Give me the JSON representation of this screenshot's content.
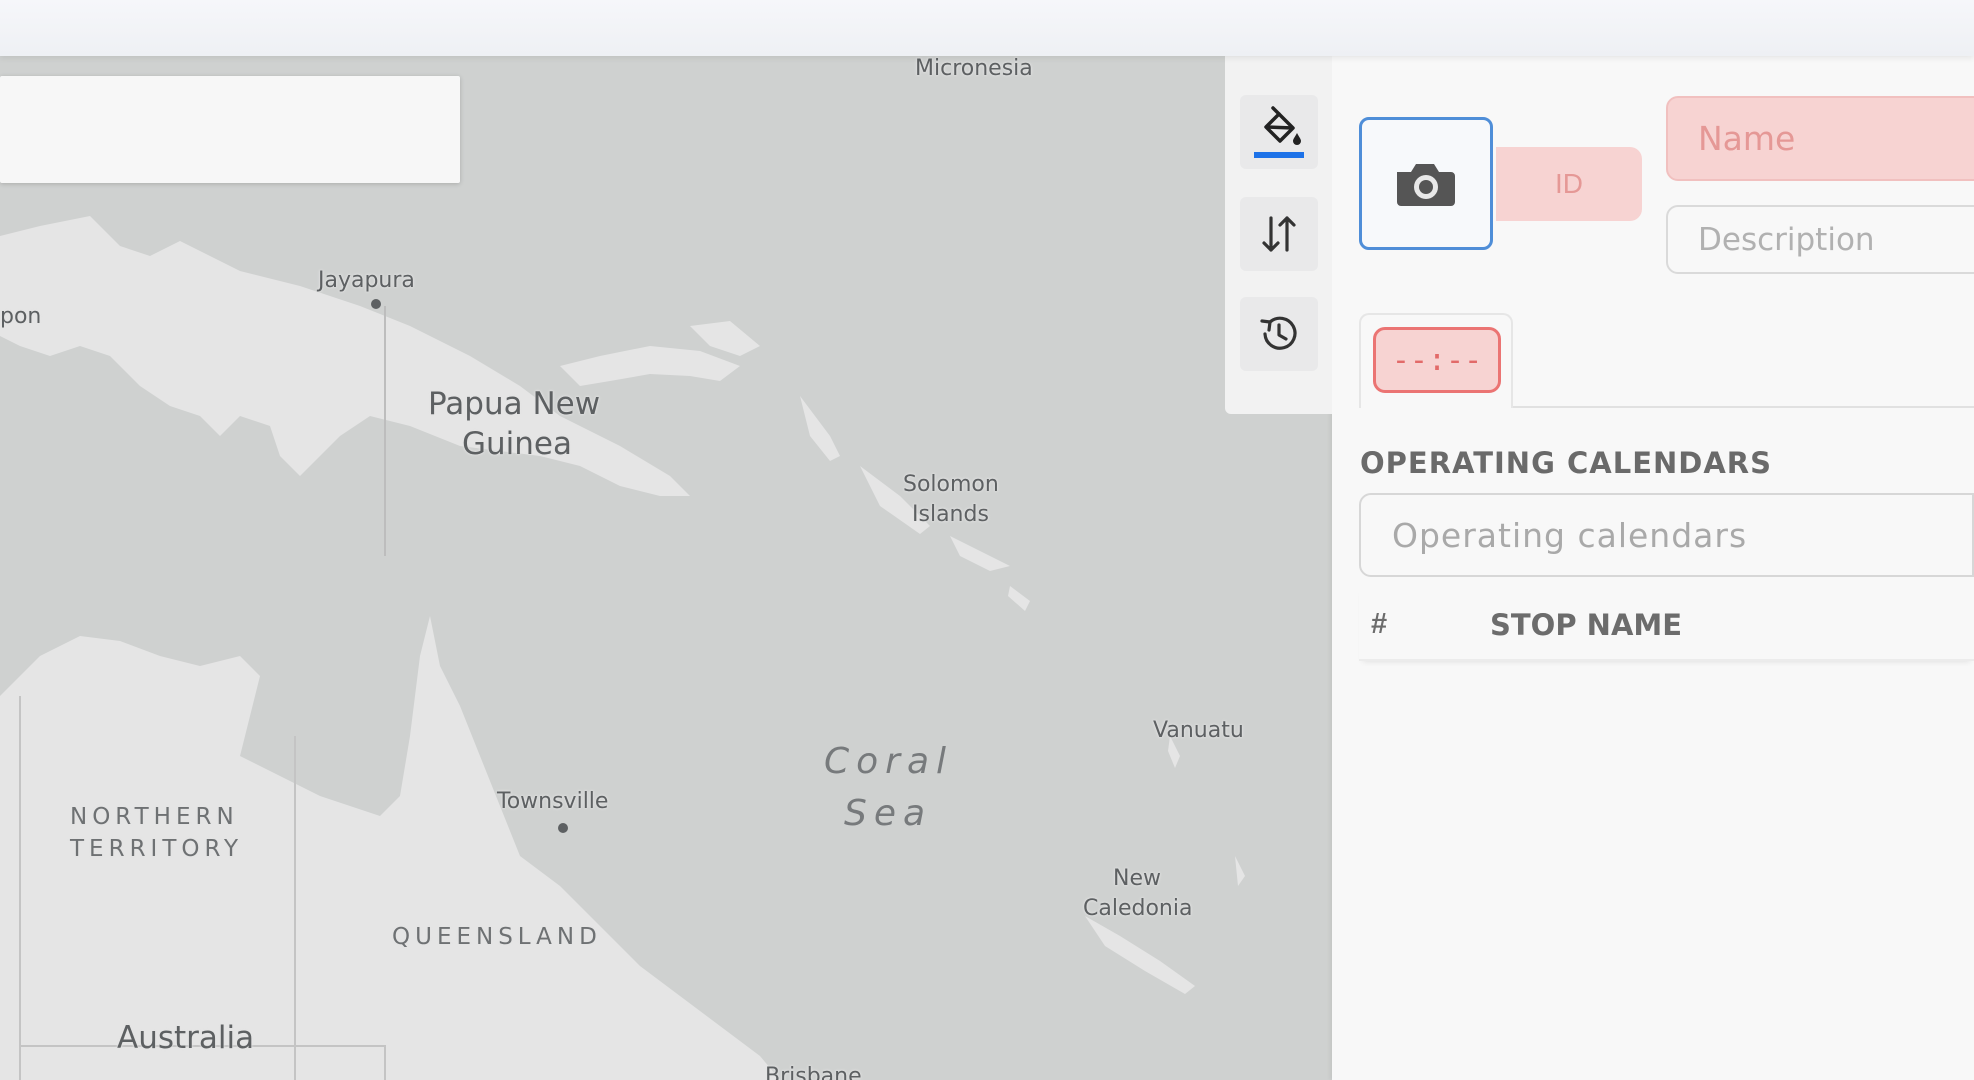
{
  "map": {
    "labels": {
      "micronesia": "Micronesia",
      "jayapura": "Jayapura",
      "pon": "pon",
      "papua_new": "Papua New",
      "guinea": "Guinea",
      "solomon": "Solomon",
      "islands": "Islands",
      "vanuatu": "Vanuatu",
      "coral": "Coral",
      "sea": "Sea",
      "townsville": "Townsville",
      "new": "New",
      "caledonia": "Caledonia",
      "northern": "NORTHERN",
      "territory": "TERRITORY",
      "queensland": "QUEENSLAND",
      "australia": "Australia",
      "brisbane": "Brisbane"
    },
    "colors": {
      "water": "#cfd1d0",
      "land": "#e5e5e5"
    }
  },
  "toolbar": {
    "icons": [
      "paint-bucket-icon",
      "sort-arrows-icon",
      "history-icon"
    ]
  },
  "panel": {
    "id_placeholder": "ID",
    "name_placeholder": "Name",
    "description_placeholder": "Description",
    "time_value": "--:--",
    "section_title": "OPERATING CALENDARS",
    "calendars_placeholder": "Operating calendars",
    "table": {
      "col_hash": "#",
      "col_stop_name": "STOP NAME"
    }
  },
  "colors": {
    "accent_blue": "#4f8ed8",
    "error_bg": "#f7d3d2",
    "error_border": "#eb7473"
  }
}
